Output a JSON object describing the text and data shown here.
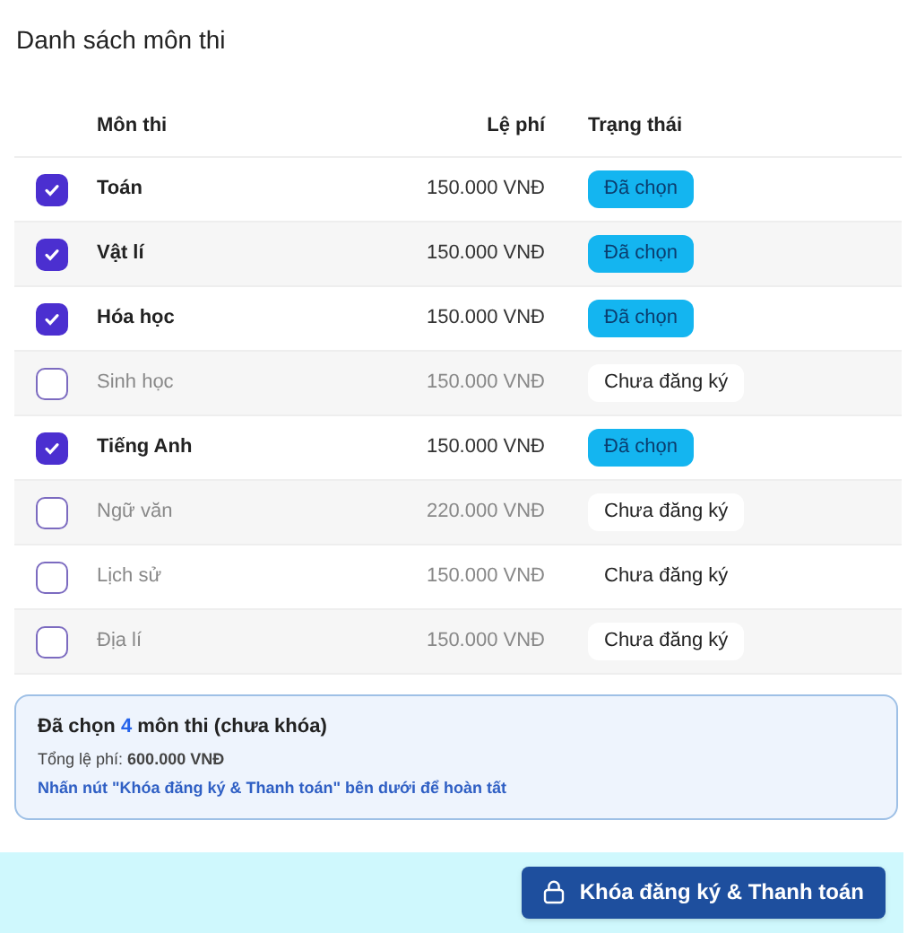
{
  "title": "Danh sách môn thi",
  "table": {
    "columns": [
      "Môn thi",
      "Lệ phí",
      "Trạng thái"
    ],
    "rows": [
      {
        "subject": "Toán",
        "fee": "150.000 VNĐ",
        "status": "Đã chọn",
        "checked": true
      },
      {
        "subject": "Vật lí",
        "fee": "150.000 VNĐ",
        "status": "Đã chọn",
        "checked": true
      },
      {
        "subject": "Hóa học",
        "fee": "150.000 VNĐ",
        "status": "Đã chọn",
        "checked": true
      },
      {
        "subject": "Sinh học",
        "fee": "150.000 VNĐ",
        "status": "Chưa đăng ký",
        "checked": false
      },
      {
        "subject": "Tiếng Anh",
        "fee": "150.000 VNĐ",
        "status": "Đã chọn",
        "checked": true
      },
      {
        "subject": "Ngữ văn",
        "fee": "220.000 VNĐ",
        "status": "Chưa đăng ký",
        "checked": false
      },
      {
        "subject": "Lịch sử",
        "fee": "150.000 VNĐ",
        "status": "Chưa đăng ký",
        "checked": false
      },
      {
        "subject": "Địa lí",
        "fee": "150.000 VNĐ",
        "status": "Chưa đăng ký",
        "checked": false
      }
    ]
  },
  "summary": {
    "selected_prefix": "Đã chọn",
    "selected_count": "4",
    "selected_suffix": "môn thi (chưa khóa)",
    "total": "Tổng lệ phí: **600.000 VNĐ**",
    "hint": "Nhấn nút \"Khóa đăng ký & Thanh toán\" bên dưới để hoàn tất"
  },
  "footer": {
    "button": "Khóa đăng ký & Thanh toán"
  }
}
